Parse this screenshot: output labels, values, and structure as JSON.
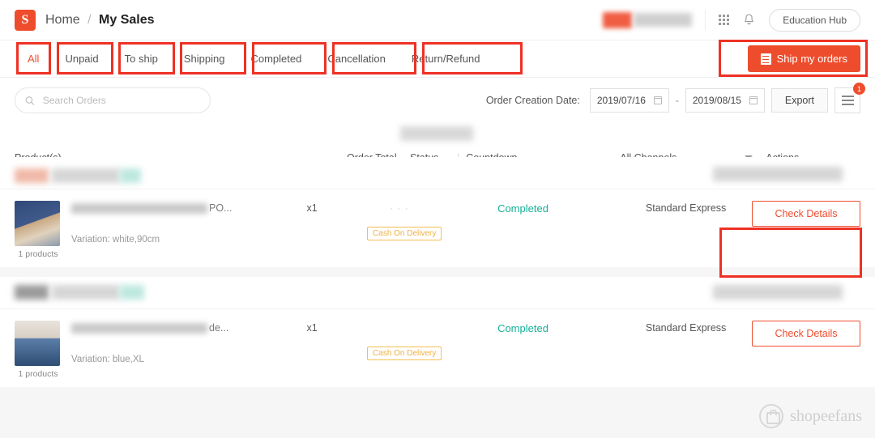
{
  "header": {
    "logo_letter": "S",
    "breadcrumb_home": "Home",
    "breadcrumb_sep": "/",
    "breadcrumb_current": "My Sales",
    "education_hub": "Education Hub"
  },
  "tabs": [
    {
      "label": "All",
      "active": true
    },
    {
      "label": "Unpaid",
      "active": false
    },
    {
      "label": "To ship",
      "active": false
    },
    {
      "label": "Shipping",
      "active": false
    },
    {
      "label": "Completed",
      "active": false
    },
    {
      "label": "Cancellation",
      "active": false
    },
    {
      "label": "Return/Refund",
      "active": false
    }
  ],
  "ship_button": {
    "label": "Ship my orders"
  },
  "filters": {
    "search_placeholder": "Search Orders",
    "search_value": "",
    "date_label": "Order Creation Date:",
    "date_from": "2019/07/16",
    "date_to": "2019/08/15",
    "date_separator": "-",
    "export_label": "Export",
    "menu_badge": "1"
  },
  "columns": {
    "product": "Product(s)",
    "order_total": "Order Total",
    "status": "Status",
    "separator": "|",
    "countdown": "Countdown",
    "channel": "All Channels",
    "actions": "Actions"
  },
  "orders": [
    {
      "title_tail": "PO...",
      "variation": "Variation: white,90cm",
      "products_count": "1 products",
      "quantity": "x1",
      "cod_tag": "Cash On Delivery",
      "status": "Completed",
      "channel": "Standard Express",
      "action_label": "Check Details"
    },
    {
      "title_tail": "de...",
      "variation": "Variation: blue,XL",
      "products_count": "1 products",
      "quantity": "x1",
      "cod_tag": "Cash On Delivery",
      "status": "Completed",
      "channel": "Standard Express",
      "action_label": "Check Details"
    }
  ],
  "watermark": {
    "text": "shopeefans"
  },
  "colors": {
    "accent": "#ee4d2d",
    "annotation": "#ee3124",
    "completed": "#15b097",
    "cod": "#f0a92e"
  }
}
